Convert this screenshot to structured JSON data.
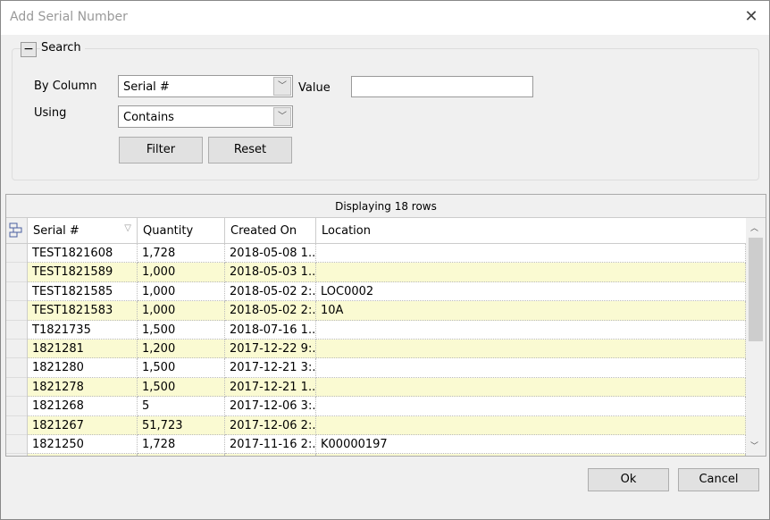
{
  "window": {
    "title": "Add Serial Number",
    "close_icon": "close-icon"
  },
  "search": {
    "group_label": "Search",
    "collapse_glyph": "−",
    "by_column_label": "By Column",
    "by_column_value": "Serial #",
    "value_label": "Value",
    "value_input": "",
    "using_label": "Using",
    "using_value": "Contains",
    "filter_label": "Filter",
    "reset_label": "Reset"
  },
  "grid": {
    "status": "Displaying 18 rows",
    "columns": [
      "Serial #",
      "Quantity",
      "Created On",
      "Location"
    ],
    "rows": [
      [
        "TEST1821608",
        "1,728",
        "2018-05-08  1...",
        ""
      ],
      [
        "TEST1821589",
        "1,000",
        "2018-05-03  1...",
        ""
      ],
      [
        "TEST1821585",
        "1,000",
        "2018-05-02  2:...",
        "LOC0002"
      ],
      [
        "TEST1821583",
        "1,000",
        "2018-05-02  2:...",
        "10A"
      ],
      [
        "T1821735",
        "1,500",
        "2018-07-16  1...",
        ""
      ],
      [
        "1821281",
        "1,200",
        "2017-12-22  9:...",
        ""
      ],
      [
        "1821280",
        "1,500",
        "2017-12-21  3:...",
        ""
      ],
      [
        "1821278",
        "1,500",
        "2017-12-21  1...",
        ""
      ],
      [
        "1821268",
        "5",
        "2017-12-06  3:...",
        ""
      ],
      [
        "1821267",
        "51,723",
        "2017-12-06  2:...",
        ""
      ],
      [
        "1821250",
        "1,728",
        "2017-11-16  2:...",
        "K00000197"
      ]
    ],
    "alt_row_color": "#fafad2"
  },
  "footer": {
    "ok_label": "Ok",
    "cancel_label": "Cancel"
  }
}
